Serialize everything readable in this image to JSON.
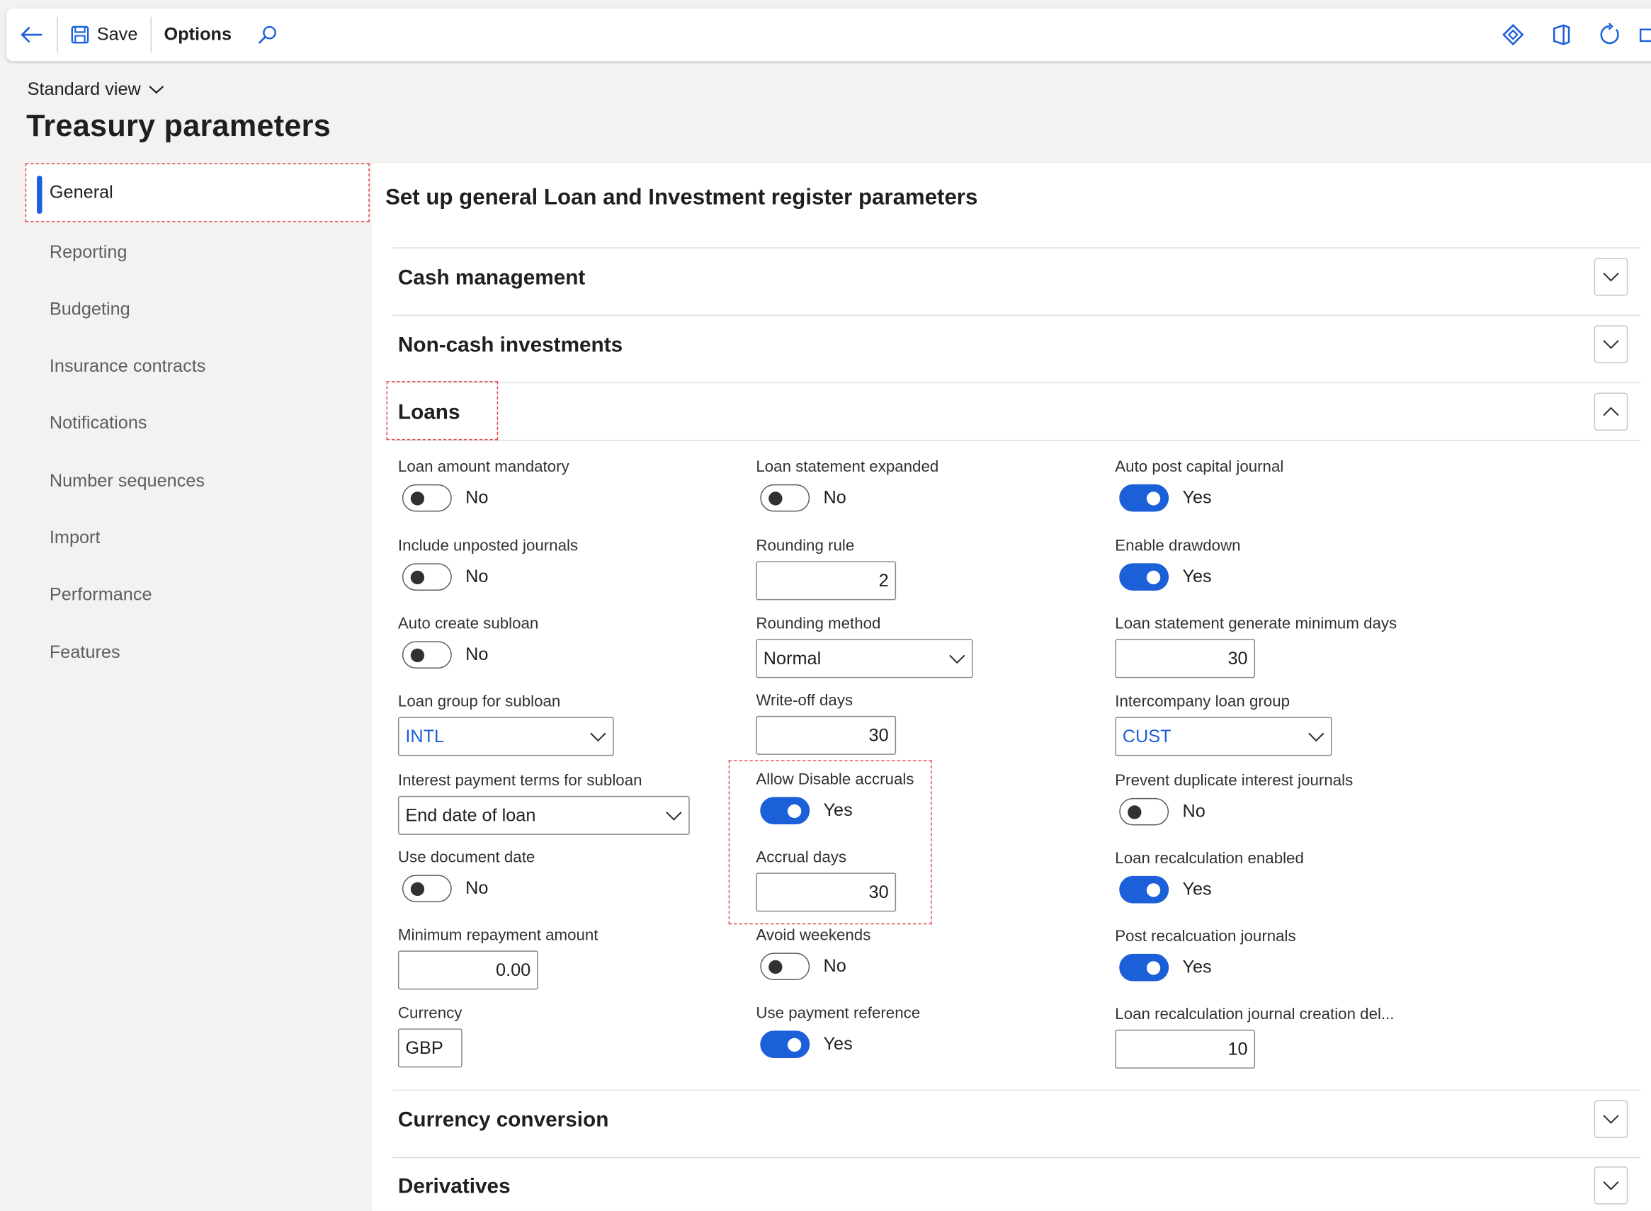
{
  "toolbar": {
    "save": "Save",
    "options": "Options"
  },
  "header": {
    "view": "Standard view",
    "title": "Treasury parameters"
  },
  "nav": {
    "active": "General",
    "items": [
      "Reporting",
      "Budgeting",
      "Insurance contracts",
      "Notifications",
      "Number sequences",
      "Import",
      "Performance",
      "Features"
    ]
  },
  "main": {
    "title": "Set up general Loan and Investment register parameters",
    "sections": {
      "cash": "Cash management",
      "noncash": "Non-cash investments",
      "loans": "Loans",
      "currency_conv": "Currency conversion",
      "derivatives": "Derivatives"
    }
  },
  "loans": {
    "loan_amount_mandatory": {
      "label": "Loan amount mandatory",
      "value": "No"
    },
    "include_unposted": {
      "label": "Include unposted journals",
      "value": "No"
    },
    "auto_create_subloan": {
      "label": "Auto create subloan",
      "value": "No"
    },
    "loan_group_subloan": {
      "label": "Loan group for subloan",
      "value": "INTL"
    },
    "interest_terms": {
      "label": "Interest payment terms for subloan",
      "value": "End date of loan"
    },
    "use_document_date": {
      "label": "Use document date",
      "value": "No"
    },
    "min_repayment": {
      "label": "Minimum repayment amount",
      "value": "0.00"
    },
    "currency": {
      "label": "Currency",
      "value": "GBP"
    },
    "statement_expanded": {
      "label": "Loan statement expanded",
      "value": "No"
    },
    "rounding_rule": {
      "label": "Rounding rule",
      "value": "2"
    },
    "rounding_method": {
      "label": "Rounding method",
      "value": "Normal"
    },
    "writeoff_days": {
      "label": "Write-off days",
      "value": "30"
    },
    "allow_disable_accruals": {
      "label": "Allow Disable accruals",
      "value": "Yes"
    },
    "accrual_days": {
      "label": "Accrual days",
      "value": "30"
    },
    "avoid_weekends": {
      "label": "Avoid weekends",
      "value": "No"
    },
    "use_payment_reference": {
      "label": "Use payment reference",
      "value": "Yes"
    },
    "auto_post_capital": {
      "label": "Auto post capital journal",
      "value": "Yes"
    },
    "enable_drawdown": {
      "label": "Enable drawdown",
      "value": "Yes"
    },
    "stmt_min_days": {
      "label": "Loan statement generate minimum days",
      "value": "30"
    },
    "interco_group": {
      "label": "Intercompany loan group",
      "value": "CUST"
    },
    "prevent_dup": {
      "label": "Prevent duplicate interest journals",
      "value": "No"
    },
    "recalc_enabled": {
      "label": "Loan recalculation enabled",
      "value": "Yes"
    },
    "post_recalc": {
      "label": "Post recalcuation journals",
      "value": "Yes"
    },
    "recalc_delay": {
      "label": "Loan recalculation journal creation del...",
      "value": "10"
    }
  },
  "colors": {
    "accent": "#1b5fd9",
    "highlight": "#e0454f"
  }
}
